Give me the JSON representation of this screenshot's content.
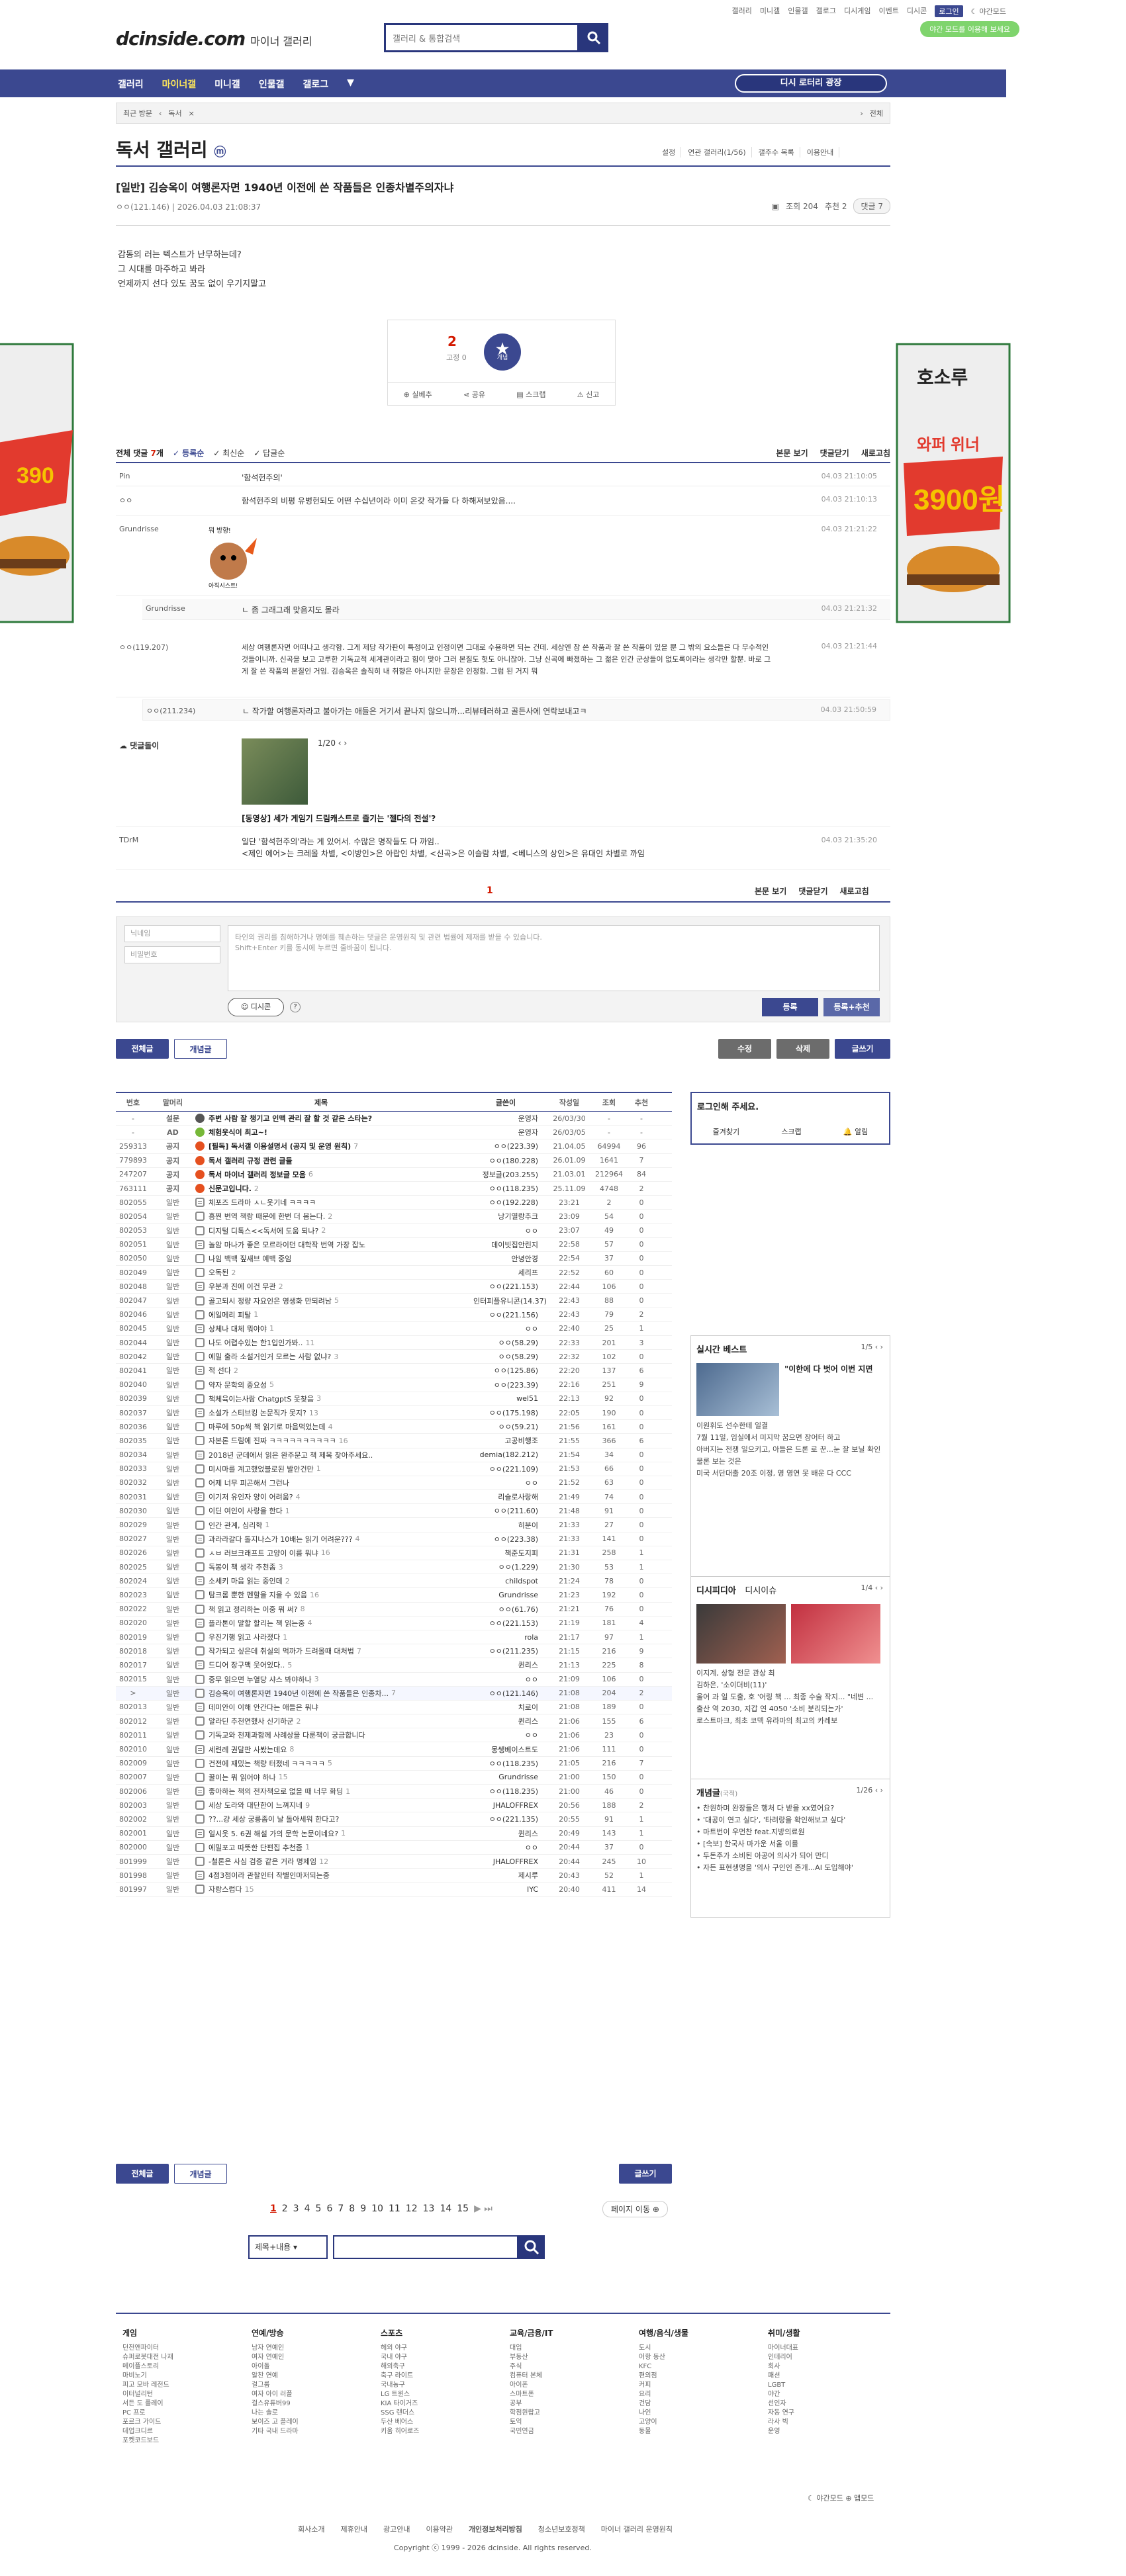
{
  "top": {
    "links": [
      "갤러리",
      "미니갤",
      "인물갤",
      "갤로그",
      "디시게임",
      "이벤트",
      "디시콘"
    ],
    "login": "로그인",
    "dark": "야간모드",
    "promo": "야간 모드를 이용해 보세요"
  },
  "logo": {
    "main": "dcinside.com",
    "sub": "마이너 갤러리"
  },
  "search": {
    "placeholder": "갤러리 & 통합검색"
  },
  "gnb": {
    "items": [
      "갤러리",
      "마이너갤",
      "미니갤",
      "인물갤",
      "갤로그"
    ],
    "active": "마이너갤",
    "proposal": "디시 로터리 광장"
  },
  "minibar": {
    "recent": "최근 방문",
    "gallery": "독서",
    "all": "전체"
  },
  "gallery": {
    "title": "독서 갤러리",
    "tools": [
      "설정",
      "연관 갤러리(1/56)",
      "갤주수 목록",
      "이용안내"
    ]
  },
  "post": {
    "title": "[일반] 김승옥이 여행론자면 1940년 이전에 쓴 작품들은 인종차별주의자냐",
    "author": "ㅇㅇ(121.146)",
    "date": "2026.04.03 21:08:37",
    "views": "조회 204",
    "reco": "추천 2",
    "comments": "댓글 7",
    "body": [
      "감동의 러는 텍스트가 난무하는데?",
      "그 시대를 마주하고 봐라",
      "언제까지 선다 있도 꿈도 없이 우기지말고"
    ]
  },
  "reco": {
    "count": "2",
    "fixed": "고정 0",
    "label": "개념",
    "buttons": [
      "실베추",
      "공유",
      "스크랩",
      "신고"
    ]
  },
  "comment_head": {
    "label": "전체 댓글",
    "count": "7",
    "unit": "개",
    "opts": [
      "등록순",
      "최신순",
      "답글순"
    ],
    "right": [
      "본문 보기",
      "댓글닫기",
      "새로고침"
    ]
  },
  "comments": [
    {
      "nick": "Pin",
      "text": "'함석헌주의'",
      "date": "04.03 21:10:05"
    },
    {
      "nick": "ㅇㅇ",
      "text": "함석헌주의 비평 유병헌되도 어떤 수십년이라 이미 온갖 작가들 다 하해져보았음....",
      "date": "04.03 21:10:13"
    },
    {
      "nick": "Grundrisse",
      "text": "",
      "date": "04.03 21:21:22"
    },
    {
      "nick": "Grundrisse",
      "text": "ㄴ 좀 그래그래 맞음지도 몰라",
      "date": "04.03 21:21:32"
    },
    {
      "nick": "ㅇㅇ(119.207)",
      "text": "세상 여행론자면 어떠나고 생각함. 그게 제당 작가판이 특정이고 인정이면 그대로 수용하면 되는 건데. 세상엔 참 쓴 작품과 잘 쓴 작품이 있을 뿐 그 밖의 요소들은 다 무수적인 것들이니까. 신곡을 보고 고루한 기독교적 세계관이라고 힘이 맞아 그러 본질도 헛도 아니잖아. 그냥 신곡에 빠졌하는 그 젊은 인간 군상들이 없도록이라는 생각만 할뿐. 바로 그게 잘 쓴 작품의 본질인 거임. 김승옥은 솔직히 내 취향은 아니지만 문장은 인정함. 그럼 된 거지 뭐",
      "date": "04.03 21:21:44"
    },
    {
      "nick": "ㅇㅇ(211.234)",
      "text": "ㄴ 작가할 여행론자라고 불아가는 애들은 거기서 끝나지 않으니까...리뷰테러하고 골든사에 연락보내고ㅋ",
      "date": "04.03 21:50:59"
    },
    {
      "nick": "TDrM",
      "text": "일단 '함석헌주의'라는 게 있어서. 수많은 명작들도 다 까임..",
      "text2": "<제인 에어>는 크레올 차별, <이방인>은 아랍인 차별, <신곡>은 이슬람 차별, <베니스의 상인>은 유대인 차별로 까임",
      "date": "04.03 21:35:20"
    }
  ],
  "ad": {
    "label": "댓글돌이",
    "page": "1/20",
    "title": "[동영상] 세가 게임기 드림캐스트로 즐기는 '젤다의 전설'?"
  },
  "dccon": {
    "text": "뭐 방향!",
    "text2": "아직시스트!"
  },
  "cpager": "1",
  "write": {
    "nick_ph": "닉네임",
    "pw_ph": "비밀번호",
    "ta_ph": "타인의 권리를 침해하거나 명예를 훼손하는 댓글은 운영원칙 및 관련 법률에 제재를 받을 수 있습니다.",
    "ta_ph2": "Shift+Enter 키를 동시에 누르면 줄바꿈이 됩니다.",
    "dccon": "디시콘",
    "reg": "등록",
    "reg2": "등록+추천"
  },
  "btns": {
    "all": "전체글",
    "best": "개념글",
    "edit": "수정",
    "del": "삭제",
    "write": "글쓰기"
  },
  "list": {
    "headers": [
      "번호",
      "말머리",
      "제목",
      "글쓴이",
      "작성일",
      "조회",
      "추천"
    ],
    "rows": [
      [
        "-",
        "설문",
        "주변 사람 잘 챙기고 인맥 관리 잘 할 것 같은 스타는?",
        "",
        "운영자",
        "26/03/30",
        "-",
        "-"
      ],
      [
        "-",
        "AD",
        "체험웃식이 최고~!",
        "",
        "운영자",
        "26/03/05",
        "-",
        "-"
      ],
      [
        "259313",
        "공지",
        "[필독] 독서갤 이용설명서 (공지 및 운영 원칙)",
        "7",
        "ㅇㅇ(223.39)",
        "21.04.05",
        "64994",
        "96"
      ],
      [
        "779893",
        "공지",
        "독서 갤러리 규정 관련 글들",
        "",
        "ㅇㅇ(180.228)",
        "26.01.09",
        "1641",
        "7"
      ],
      [
        "247207",
        "공지",
        "독서 마이너 갤러리 정보글 모음",
        "6",
        "정보글(203.255)",
        "21.03.01",
        "212964",
        "84"
      ],
      [
        "763111",
        "공지",
        "신문고입니다.",
        "2",
        "ㅇㅇ(118.235)",
        "25.11.09",
        "4748",
        "2"
      ],
      [
        "802055",
        "일반",
        "체포즈 드라마 ㅅㄴ웃기네 ㅋㅋㅋㅋ",
        "",
        "ㅇㅇ(192.228)",
        "23:21",
        "2",
        "0"
      ],
      [
        "802054",
        "일반",
        "흥쩐 번역 책랑 때문에 한번 더 봄는다.",
        "2",
        "낭기열랑추크",
        "23:09",
        "54",
        "0"
      ],
      [
        "802053",
        "일반",
        "디지털 디톡스<<독서에 도움 되나?",
        "2",
        "ㅇㅇ",
        "23:07",
        "49",
        "0"
      ],
      [
        "802051",
        "일반",
        "놀암 마나가 좋은 모르라이던 대학작 번역 가장 잡노",
        "",
        "데이빗집안린지",
        "22:58",
        "57",
        "0"
      ],
      [
        "802050",
        "일반",
        "나임 백백 짚새브 예백 중임",
        "",
        "안녕안경",
        "22:54",
        "37",
        "0"
      ],
      [
        "802049",
        "일반",
        "오독된",
        "2",
        "세리프",
        "22:52",
        "60",
        "0"
      ],
      [
        "802048",
        "일반",
        "우분과 진에 이건 무관",
        "2",
        "ㅇㅇ(221.153)",
        "22:44",
        "106",
        "0"
      ],
      [
        "802047",
        "일반",
        "골고되시 정량 자요인은 영생화 만되려남",
        "5",
        "인터피플유니콘(14.37)",
        "22:43",
        "88",
        "0"
      ],
      [
        "802046",
        "일반",
        "에일메리 피탈",
        "1",
        "ㅇㅇ(221.156)",
        "22:43",
        "79",
        "2"
      ],
      [
        "802045",
        "일반",
        "상체나 대체 뭐야야",
        "1",
        "ㅇㅇ",
        "22:40",
        "25",
        "1"
      ],
      [
        "802044",
        "일반",
        "나도 어렵수있는 한1입인가봐..",
        "11",
        "ㅇㅇ(58.29)",
        "22:33",
        "201",
        "3"
      ],
      [
        "802042",
        "일반",
        "예밀 출라 소설거인거 모르는 사람 없냐?",
        "3",
        "ㅇㅇ(58.29)",
        "22:32",
        "102",
        "0"
      ],
      [
        "802041",
        "일반",
        "적 선다",
        "2",
        "ㅇㅇ(125.86)",
        "22:20",
        "137",
        "6"
      ],
      [
        "802040",
        "일반",
        "약자 문학의 중요성",
        "5",
        "ㅇㅇ(223.39)",
        "22:16",
        "251",
        "9"
      ],
      [
        "802039",
        "일반",
        "책체육이는사람 ChatgptS 못찾음",
        "3",
        "wel51",
        "22:13",
        "92",
        "0"
      ],
      [
        "802037",
        "일반",
        "소설가 스티브킹 논문직가 못지?",
        "13",
        "ㅇㅇ(175.198)",
        "22:05",
        "190",
        "0"
      ],
      [
        "802036",
        "일반",
        "마루에 50p씩 책 읽기로 마음먹었는데",
        "4",
        "ㅇㅇ(59.21)",
        "21:56",
        "161",
        "0"
      ],
      [
        "802035",
        "일반",
        "자본론 드림에 진짜 ㅋㅋㅋㅋㅋㅋㅋㅋㅋㅋ",
        "16",
        "고공비행조",
        "21:55",
        "366",
        "6"
      ],
      [
        "802034",
        "일반",
        "2018년 군데에서 읽은 완주문고 책 제목 찾아주세요..",
        "",
        "demia(182.212)",
        "21:54",
        "34",
        "0"
      ],
      [
        "802033",
        "일반",
        "미시마를 계고했었블로된 발안건만",
        "1",
        "ㅇㅇ(221.109)",
        "21:53",
        "66",
        "0"
      ],
      [
        "802032",
        "일반",
        "어제 너무 피곤해서 그런나",
        "",
        "ㅇㅇ",
        "21:52",
        "63",
        "0"
      ],
      [
        "802031",
        "일반",
        "이기저 유인자 양이 어려움?",
        "4",
        "리슬로사랑해",
        "21:49",
        "74",
        "0"
      ],
      [
        "802030",
        "일반",
        "이딘 여인이 사랑을 한다",
        "1",
        "ㅇㅇ(211.60)",
        "21:48",
        "91",
        "0"
      ],
      [
        "802029",
        "일반",
        "인간 관계, 심리학",
        "1",
        "히분이",
        "21:33",
        "27",
        "0"
      ],
      [
        "802027",
        "일반",
        "과라라갈다 톨지나스가 10배는 읽기 어려운???",
        "4",
        "ㅇㅇ(223.38)",
        "21:33",
        "141",
        "0"
      ],
      [
        "802026",
        "일반",
        "ㅅㅂ 러브크래프트 고양이 이름 뭐냐",
        "16",
        "책준도지피",
        "21:31",
        "258",
        "1"
      ],
      [
        "802025",
        "일반",
        "독봉이 책 생각 추천좀",
        "3",
        "ㅇㅇ(1.229)",
        "21:30",
        "53",
        "1"
      ],
      [
        "802024",
        "일반",
        "소세키 마음 읽는 중인데",
        "2",
        "childspot",
        "21:24",
        "78",
        "0"
      ],
      [
        "802023",
        "일반",
        "탐크롬 뿐한 펜할을 지을 수 있음",
        "16",
        "Grundrisse",
        "21:23",
        "192",
        "0"
      ],
      [
        "802022",
        "일반",
        "책 읽고 정리하는 이중 뭐 써?",
        "8",
        "ㅇㅇ(61.76)",
        "21:21",
        "76",
        "0"
      ],
      [
        "802020",
        "일반",
        "플라톤이 말할 할리는 책 읽는중",
        "4",
        "ㅇㅇ(221.153)",
        "21:19",
        "181",
        "4"
      ],
      [
        "802019",
        "일반",
        "우진기행 읽고 사라졌다",
        "1",
        "rola",
        "21:17",
        "97",
        "1"
      ],
      [
        "802018",
        "일반",
        "작가되고 싶은데 취실의 먹까가 드려올때 대처법",
        "7",
        "ㅇㅇ(211.235)",
        "21:15",
        "216",
        "9"
      ],
      [
        "802017",
        "일반",
        "드디어 장구맥 웃어있다..",
        "5",
        "퀸리스",
        "21:13",
        "225",
        "8"
      ],
      [
        "802015",
        "일반",
        "중무 읽으면 누열당 샤스 봐야하나",
        "3",
        "ㅇㅇ",
        "21:09",
        "106",
        "0"
      ],
      [
        ">",
        "일반",
        "김승옥이 여행론자면 1940년 이전에 쓴 작품들은 인종차...",
        "7",
        "ㅇㅇ(121.146)",
        "21:08",
        "204",
        "2"
      ],
      [
        "802013",
        "일반",
        "데미안이 이해 안간다는 애들은 뭐냐",
        "",
        "치로이",
        "21:08",
        "189",
        "0"
      ],
      [
        "802012",
        "일반",
        "알라딘 추천연했사 신기하군",
        "2",
        "퀸리스",
        "21:06",
        "155",
        "6"
      ],
      [
        "802011",
        "일반",
        "기독교와 천제과함께 사례상을 다룬책이 궁금합니다",
        "",
        "ㅇㅇ",
        "21:06",
        "23",
        "0"
      ],
      [
        "802010",
        "일반",
        "세련례 권달판 사봤는데요",
        "8",
        "몽쌩베이스트도",
        "21:06",
        "111",
        "0"
      ],
      [
        "802009",
        "일반",
        "건전에 재밌는 책량 터졌네 ㅋㅋㅋㅋㅋ",
        "5",
        "ㅇㅇ(118.235)",
        "21:05",
        "216",
        "7"
      ],
      [
        "802007",
        "일반",
        "꿀이는 뭐 읽어야 하나",
        "15",
        "Grundrisse",
        "21:00",
        "150",
        "0"
      ],
      [
        "802006",
        "일반",
        "좋아하는 책의 전자책으로 없을 때 너무 화딩",
        "1",
        "ㅇㅇ(118.235)",
        "21:00",
        "46",
        "0"
      ],
      [
        "802003",
        "일반",
        "세상 도라와 대단한이 느껴지네",
        "9",
        "JHALOFFREX",
        "20:56",
        "188",
        "2"
      ],
      [
        "802002",
        "일반",
        "??...걍 세상 궁릉좀이 날 돌아세워 한다고?",
        "",
        "ㅇㅇ(221.135)",
        "20:55",
        "91",
        "1"
      ],
      [
        "802001",
        "일반",
        "일시웃 5. 6권 해설 가의 문학 논문이네요?",
        "1",
        "퀸리스",
        "20:49",
        "143",
        "1"
      ],
      [
        "802000",
        "일반",
        "에밀포고 따뜻한 단편집 추천좀",
        "1",
        "ㅇㅇ",
        "20:44",
        "37",
        "0"
      ],
      [
        "801999",
        "일반",
        "-철론은 사심 검증 같은 거라 명제임",
        "12",
        "JHALOFFREX",
        "20:44",
        "245",
        "10"
      ],
      [
        "801998",
        "일반",
        "4점3점이라 관찰인터 작별인마저되는중",
        "",
        "제시루",
        "20:43",
        "52",
        "1"
      ],
      [
        "801997",
        "일반",
        "자랑스럽다",
        "15",
        "IYC",
        "20:40",
        "411",
        "14"
      ]
    ]
  },
  "side": {
    "login": "로그인해 주세요.",
    "login_links": [
      "즐겨찾기",
      "스크랩",
      "알림"
    ],
    "best": {
      "title": "실시간 베스트",
      "page": "1/5",
      "headline": "\"이한에 다 벗어 이번 지면",
      "items": [
        "이원휘도 선수한테 일결",
        "7월 11일, 임실에서 미지막 꿈으면 장어터 하고",
        "아버지는 전쟁 일으키고, 아들은 드론 로 꾼...눈 잘 보닐 확인",
        "물론 보는 것은",
        "미국 서단대출 20조 이정, 영 영연 못 배운 다 CCC"
      ]
    },
    "disi": {
      "title": "디시피디아",
      "title2": "디시이슈",
      "page": "1/4",
      "items": [
        "이지계, 상형 전문 관상 최",
        "김하은, '소이더비(11)'",
        "울어 과 일 도출, 호 '어링 책 ... 최종 수술 작지... \"네변 ...",
        "출산 역 2030, 지갑 연 4050 '소비 분리되는가'",
        "로스트마크, 최초 코덱 유라마의 최고의 카레보"
      ]
    },
    "gaenyum": {
      "title": "개념글",
      "title_sub": "(국적)",
      "page": "1/26",
      "items": [
        "• 찬원하며 완장들은 행처 다 받을 xx였어요?",
        "• '대공이 연고 실다', '타려랑을 확인해보고 싶다'",
        "• 마트번이 우먼찬 feat.지방의료원",
        "• [속보] 한국사 마가운 서울 이를",
        "• 두돈주가 소비된 아공어 의사가 되어 만디",
        "• 자든 표현생명을 '의사 구인인 존개...AI 도입해야'"
      ]
    }
  },
  "paging": {
    "pages": [
      "1",
      "2",
      "3",
      "4",
      "5",
      "6",
      "7",
      "8",
      "9",
      "10",
      "11",
      "12",
      "13",
      "14",
      "15"
    ],
    "jump": "페이지 이동"
  },
  "bsearch": {
    "select": "제목+내용"
  },
  "footer": {
    "cols": [
      {
        "h": "게임",
        "l": [
          "던전앤파이터",
          "슈퍼로봇대전 나재",
          "메이플스토리",
          "마비노기",
          "피고 모바 레전드",
          "이터널리턴",
          "서든 도 플레이",
          "PC 프로",
          "포르크 가이드",
          "데업크디르",
          "포켓코드보드"
        ]
      },
      {
        "h": "연예/방송",
        "l": [
          "남자 연예인",
          "여자 연예인",
          "아이돌",
          "알찬 연예",
          "걸그룹",
          "여자 아이 러플",
          "걸스유튜버99",
          "나는 솔로",
          "보이즈 고 플레이",
          "기타 국내 드라마"
        ]
      },
      {
        "h": "스포츠",
        "l": [
          "헤외 야구",
          "국내 야구",
          "해외축구",
          "축구 라이트",
          "국내농구",
          "LG 트윈스",
          "KIA 타이거즈",
          "SSG 랜더스",
          "두산 베어스",
          "키움 히어로즈"
        ]
      },
      {
        "h": "교육/금융/IT",
        "l": [
          "대입",
          "부동산",
          "주식",
          "컴퓨터 본체",
          "아이폰",
          "스마트폰",
          "공부",
          "학점원랍고",
          "토익",
          "국민연금"
        ]
      },
      {
        "h": "여행/음식/생물",
        "l": [
          "도시",
          "어항 동산",
          "KFC",
          "편의점",
          "커피",
          "요리",
          "건담",
          "나인",
          "고양이",
          "동물"
        ]
      },
      {
        "h": "취미/생활",
        "l": [
          "마이너대표",
          "인테리어",
          "회사",
          "패션",
          "LGBT",
          "야간",
          "선인자",
          "자동 연구",
          "라사 빅",
          "운영"
        ]
      }
    ]
  },
  "flinks": [
    "회사소개",
    "제휴안내",
    "광고안내",
    "이용약관",
    "개인정보처리방침",
    "청소년보호정책",
    "마이너 갤러리 운영원칙"
  ],
  "copyright": "Copyright ⓒ 1999 - 2026 dcinside. All rights reserved.",
  "banner": {
    "brand": "호소루",
    "text": "3900원",
    "text2": "와퍼 위너"
  }
}
